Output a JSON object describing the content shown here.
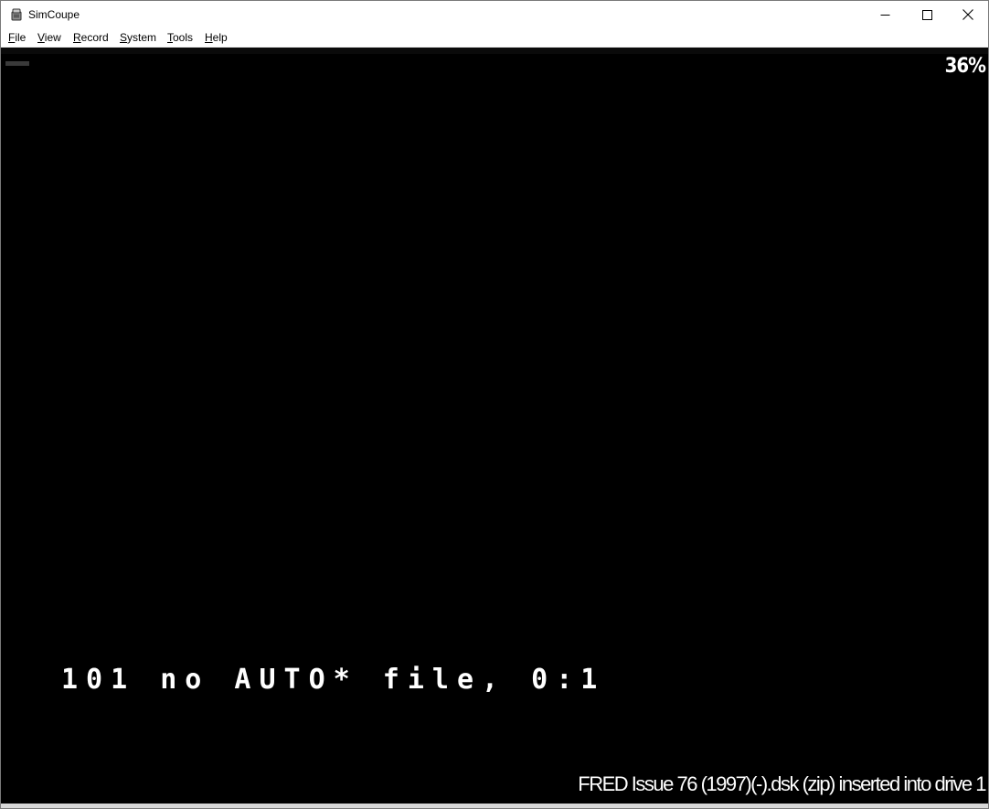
{
  "window": {
    "title": "SimCoupe"
  },
  "menubar": {
    "items": [
      {
        "label_mnemonic": "F",
        "label_rest": "ile"
      },
      {
        "label_mnemonic": "V",
        "label_rest": "iew"
      },
      {
        "label_mnemonic": "R",
        "label_rest": "ecord"
      },
      {
        "label_mnemonic": "S",
        "label_rest": "ystem"
      },
      {
        "label_mnemonic": "T",
        "label_rest": "ools"
      },
      {
        "label_mnemonic": "H",
        "label_rest": "elp"
      }
    ]
  },
  "emulator": {
    "speed": "36%",
    "error_message": "101 no AUTO* file, 0:1",
    "status_message": "FRED Issue 76 (1997)(-).dsk (zip)  inserted into drive 1"
  },
  "icons": {
    "app": "simcoupe-app-icon",
    "minimize": "minimize-icon",
    "maximize": "maximize-icon",
    "close": "close-icon"
  },
  "colors": {
    "screen_background": "#000000",
    "screen_text": "#ffffff",
    "chrome_background": "#ffffff"
  }
}
